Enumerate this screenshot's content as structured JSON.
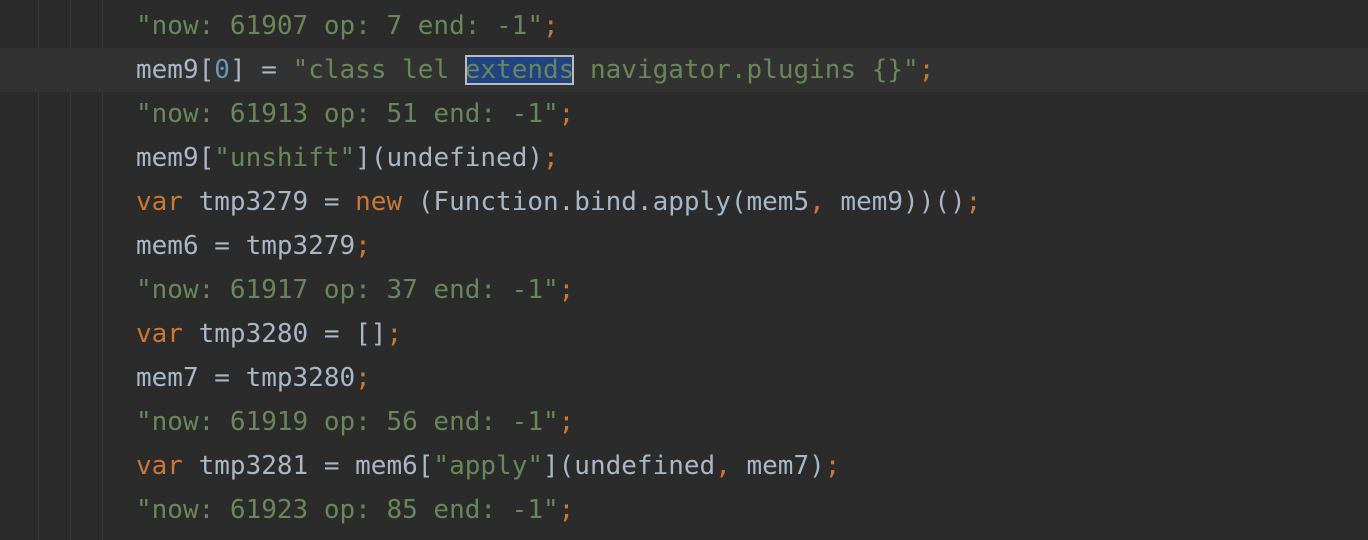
{
  "colors": {
    "background": "#2b2b2b",
    "current_line": "#323232",
    "string": "#6a8759",
    "keyword": "#cc7832",
    "number": "#6897bb",
    "identifier": "#a9b7c6",
    "selection": "#214283"
  },
  "lines": [
    {
      "tokens": [
        {
          "t": "\"now: 61907 op: 7 end: -1\"",
          "c": "s"
        },
        {
          "t": ";",
          "c": "p"
        }
      ]
    },
    {
      "current": true,
      "tokens": [
        {
          "t": "mem9[",
          "c": "i"
        },
        {
          "t": "0",
          "c": "n"
        },
        {
          "t": "] = ",
          "c": "i"
        },
        {
          "t": "\"class lel ",
          "c": "s"
        },
        {
          "t": "extends",
          "c": "hl"
        },
        {
          "t": " navigator.plugins {}\"",
          "c": "s"
        },
        {
          "t": ";",
          "c": "p"
        }
      ]
    },
    {
      "tokens": [
        {
          "t": "\"now: 61913 op: 51 end: -1\"",
          "c": "s"
        },
        {
          "t": ";",
          "c": "p"
        }
      ]
    },
    {
      "tokens": [
        {
          "t": "mem9[",
          "c": "i"
        },
        {
          "t": "\"unshift\"",
          "c": "s"
        },
        {
          "t": "](undefined)",
          "c": "i"
        },
        {
          "t": ";",
          "c": "p"
        }
      ]
    },
    {
      "tokens": [
        {
          "t": "var",
          "c": "k"
        },
        {
          "t": " tmp3279 = ",
          "c": "i"
        },
        {
          "t": "new",
          "c": "k"
        },
        {
          "t": " (Function.bind.apply(mem5",
          "c": "i"
        },
        {
          "t": ",",
          "c": "p"
        },
        {
          "t": " mem9))()",
          "c": "i"
        },
        {
          "t": ";",
          "c": "p"
        }
      ]
    },
    {
      "tokens": [
        {
          "t": "mem6 = tmp3279",
          "c": "i"
        },
        {
          "t": ";",
          "c": "p"
        }
      ]
    },
    {
      "tokens": [
        {
          "t": "\"now: 61917 op: 37 end: -1\"",
          "c": "s"
        },
        {
          "t": ";",
          "c": "p"
        }
      ]
    },
    {
      "tokens": [
        {
          "t": "var",
          "c": "k"
        },
        {
          "t": " tmp3280 = []",
          "c": "i"
        },
        {
          "t": ";",
          "c": "p"
        }
      ]
    },
    {
      "tokens": [
        {
          "t": "mem7 = tmp3280",
          "c": "i"
        },
        {
          "t": ";",
          "c": "p"
        }
      ]
    },
    {
      "tokens": [
        {
          "t": "\"now: 61919 op: 56 end: -1\"",
          "c": "s"
        },
        {
          "t": ";",
          "c": "p"
        }
      ]
    },
    {
      "tokens": [
        {
          "t": "var",
          "c": "k"
        },
        {
          "t": " tmp3281 = mem6[",
          "c": "i"
        },
        {
          "t": "\"apply\"",
          "c": "s"
        },
        {
          "t": "](undefined",
          "c": "i"
        },
        {
          "t": ",",
          "c": "p"
        },
        {
          "t": " mem7)",
          "c": "i"
        },
        {
          "t": ";",
          "c": "p"
        }
      ]
    },
    {
      "tokens": [
        {
          "t": "\"now: 61923 op: 85 end: -1\"",
          "c": "s"
        },
        {
          "t": ";",
          "c": "p"
        }
      ]
    }
  ]
}
